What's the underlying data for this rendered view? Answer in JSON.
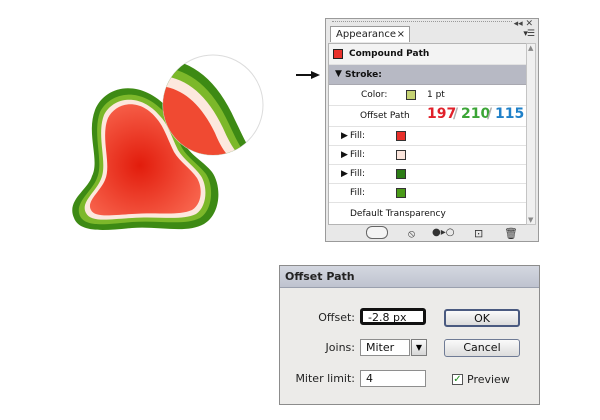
{
  "appearance_panel": {
    "tab_label": "Appearance",
    "tab_close": "×",
    "menu_icon": "▾☰",
    "object_label": "Compound Path",
    "stroke_label": "Stroke:",
    "color_label": "Color:",
    "stroke_weight": "1 pt",
    "offset_path_label": "Offset Path",
    "rgb_r": "197",
    "rgb_g": "210",
    "rgb_b": "115",
    "rgb_sep1": "/",
    "rgb_sep2": "/",
    "fill_label": "Fill:",
    "expand_icon": "▶",
    "collapse_icon": "▼",
    "default_transparency": "Default Transparency",
    "fill_colors": [
      "#e8302a",
      "#fbe5dc",
      "#2d7d16",
      "#4a9a18"
    ],
    "color_swatch": "#c5d273",
    "object_swatch": "#e8302a",
    "rgb_colors": {
      "r": "#e0202a",
      "g": "#3ba536",
      "b": "#1f80c8"
    },
    "bottom_icons": [
      "new-art-icon",
      "clear-appearance-icon",
      "reduce-basic-icon",
      "duplicate-item-icon",
      "delete-icon"
    ]
  },
  "dialog": {
    "title": "Offset Path",
    "offset_label": "Offset:",
    "offset_value": "-2.8 px",
    "joins_label": "Joins:",
    "joins_value": "Miter",
    "miter_label": "Miter limit:",
    "miter_value": "4",
    "ok_label": "OK",
    "cancel_label": "Cancel",
    "preview_label": "Preview",
    "preview_checked": true
  },
  "illustration": {
    "shape_red": "#e8341f",
    "shape_pink": "#fce8de",
    "shape_light_green": "#7cb82a",
    "shape_dark_green": "#3d8a14",
    "pointer": "arrow-right-icon"
  }
}
